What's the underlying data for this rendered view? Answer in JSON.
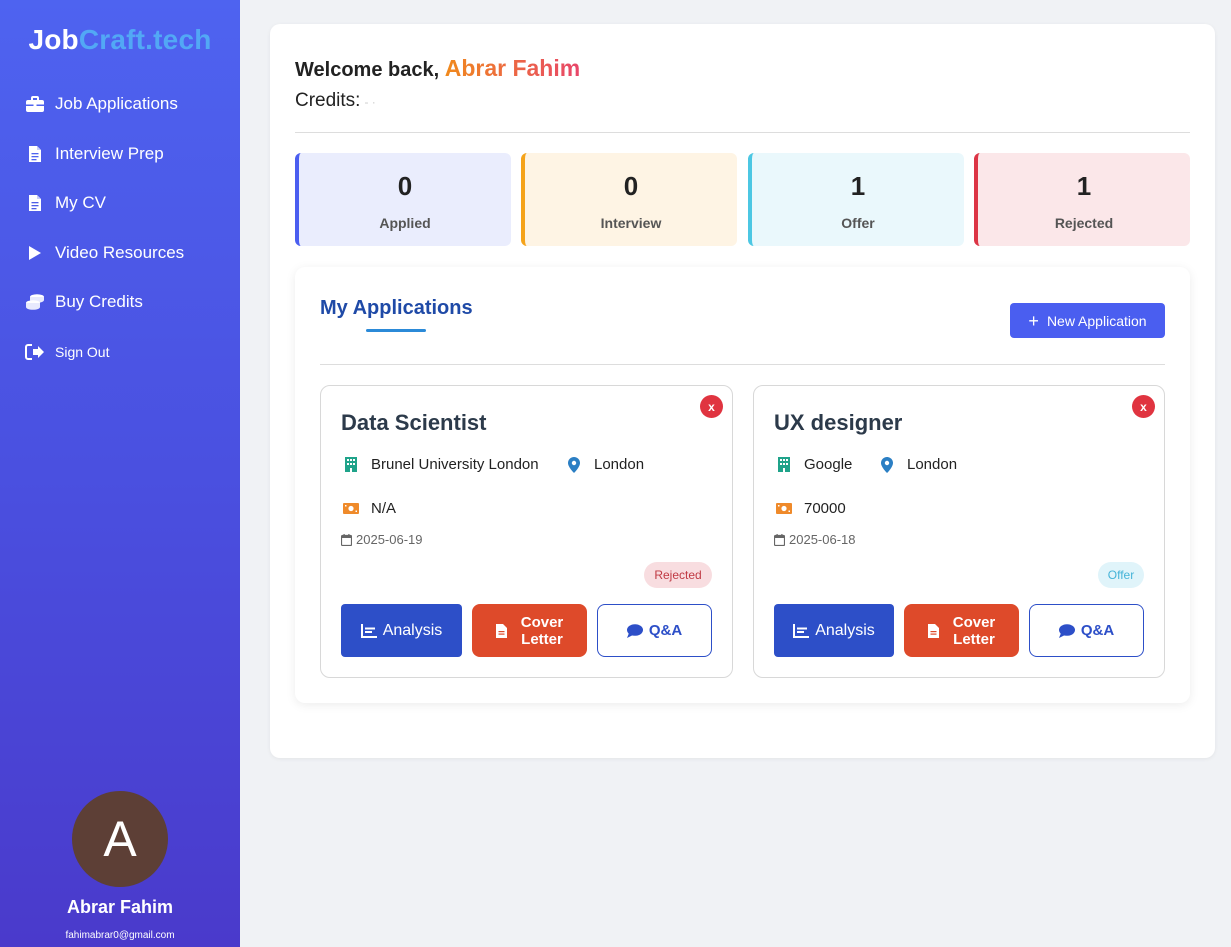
{
  "sidebar": {
    "brand_part1": "Job",
    "brand_part2": "Craft.tech",
    "items": [
      {
        "label": "Job Applications",
        "icon": "briefcase-icon"
      },
      {
        "label": "Interview Prep",
        "icon": "document-icon"
      },
      {
        "label": "My CV",
        "icon": "document-icon"
      },
      {
        "label": "Video Resources",
        "icon": "play-icon"
      },
      {
        "label": "Buy Credits",
        "icon": "coins-icon"
      },
      {
        "label": "Sign Out",
        "icon": "sign-out-icon"
      }
    ],
    "avatar_letter": "A",
    "user_name": "Abrar Fahim",
    "user_email": "fahimabrar0@gmail.com"
  },
  "header": {
    "welcome_prefix": "Welcome back,",
    "user_name": "Abrar Fahim",
    "credits_label": "Credits:",
    "credits_value": "- ·"
  },
  "stats": [
    {
      "value": "0",
      "label": "Applied",
      "color": "#4a5ef0",
      "bg": "#eaedfd"
    },
    {
      "value": "0",
      "label": "Interview",
      "color": "#f5a31a",
      "bg": "#fef4e4"
    },
    {
      "value": "1",
      "label": "Offer",
      "color": "#4cc7e3",
      "bg": "#eaf8fc"
    },
    {
      "value": "1",
      "label": "Rejected",
      "color": "#dc3545",
      "bg": "#fbe7e9"
    }
  ],
  "applications": {
    "title": "My Applications",
    "new_button": "New Application",
    "close_label": "x",
    "jobs": [
      {
        "title": "Data Scientist",
        "company": "Brunel University London",
        "location": "London",
        "salary": "N/A",
        "date": "2025-06-19",
        "status": "Rejected"
      },
      {
        "title": "UX designer",
        "company": "Google",
        "location": "London",
        "salary": "70000",
        "date": "2025-06-18",
        "status": "Offer"
      }
    ],
    "buttons": {
      "analysis": "Analysis",
      "cover_line1": "Cover",
      "cover_line2": "Letter",
      "qa": "Q&A"
    }
  },
  "colors": {
    "sidebar_top": "#4e63f0",
    "sidebar_bottom": "#4a3acb",
    "primary": "#4a5ef0",
    "analysis": "#2d4fc8",
    "cover": "#de4a2a",
    "close": "#e03440"
  }
}
